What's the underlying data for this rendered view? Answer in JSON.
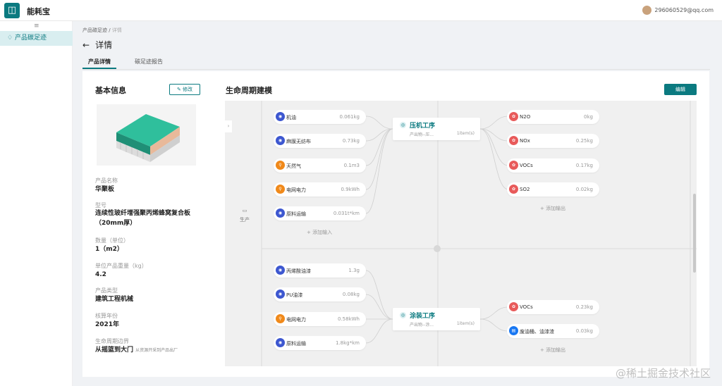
{
  "app": {
    "name": "能耗宝",
    "logo_char": "◫",
    "user_email": "296060529@qq.com"
  },
  "sidebar": {
    "collapse_icon": "≡",
    "items": [
      {
        "label": "产品碳足迹",
        "icon": "leaf-icon"
      }
    ]
  },
  "breadcrumb": {
    "parent": "产品碳足迹",
    "sep": "/",
    "current": "详情"
  },
  "page": {
    "back_icon": "←",
    "title": "详情"
  },
  "tabs": [
    {
      "label": "产品详情",
      "active": true
    },
    {
      "label": "碳足迹报告",
      "active": false
    }
  ],
  "basic": {
    "title": "基本信息",
    "edit_label": "修改",
    "fields": [
      {
        "label": "产品名称",
        "value": "华聚板",
        "sub": ""
      },
      {
        "label": "型号",
        "value": "连续性玻纤增强聚丙烯蜂窝复合板（20mm厚）",
        "sub": ""
      },
      {
        "label": "数量（单位）",
        "value": "1（m2）",
        "sub": ""
      },
      {
        "label": "单位产品重量（kg）",
        "value": "4.2",
        "sub": ""
      },
      {
        "label": "产品类型",
        "value": "建筑工程机械",
        "sub": ""
      },
      {
        "label": "核算年份",
        "value": "2021年",
        "sub": ""
      },
      {
        "label": "生命周期边界",
        "value": "从摇篮到大门",
        "sub": "从资源开采到产品出厂"
      }
    ]
  },
  "lifecycle": {
    "title": "生命周期建模",
    "edit_label": "编辑",
    "stage_label": "生产",
    "stage_icon": "▭",
    "expand_icon": "›",
    "add_input": "+ 添加输入",
    "add_output": "+ 添加输出",
    "processes": [
      {
        "name": "压机工序",
        "sub": "产出物--压...",
        "amount": "1item(s)",
        "icon": "◎",
        "inputs": [
          {
            "name": "机油",
            "value": "0.061kg",
            "icon": "blue"
          },
          {
            "name": "麻膜无纺布",
            "value": "0.73kg",
            "icon": "blue"
          },
          {
            "name": "天然气",
            "value": "0.1m3",
            "icon": "orange"
          },
          {
            "name": "电网电力",
            "value": "0.9kWh",
            "icon": "orange"
          },
          {
            "name": "原料运输",
            "value": "0.031t*km",
            "icon": "blue"
          }
        ],
        "outputs": [
          {
            "name": "N2O",
            "value": "0kg",
            "icon": "red"
          },
          {
            "name": "NOx",
            "value": "0.25kg",
            "icon": "red"
          },
          {
            "name": "VOCs",
            "value": "0.17kg",
            "icon": "red"
          },
          {
            "name": "SO2",
            "value": "0.02kg",
            "icon": "red"
          }
        ]
      },
      {
        "name": "涂装工序",
        "sub": "产出物--涂...",
        "amount": "1item(s)",
        "icon": "◎",
        "inputs": [
          {
            "name": "丙烯酸油漆",
            "value": "1.3g",
            "icon": "blue"
          },
          {
            "name": "PU油漆",
            "value": "0.08kg",
            "icon": "blue"
          },
          {
            "name": "电网电力",
            "value": "0.58kWh",
            "icon": "orange"
          },
          {
            "name": "原料运输",
            "value": "1.8kg*km",
            "icon": "blue"
          }
        ],
        "outputs": [
          {
            "name": "VOCs",
            "value": "0.23kg",
            "icon": "red"
          },
          {
            "name": "废油桶、油漆渣",
            "value": "0.03kg",
            "icon": "blueb"
          }
        ]
      }
    ]
  },
  "watermark": "@稀土掘金技术社区"
}
